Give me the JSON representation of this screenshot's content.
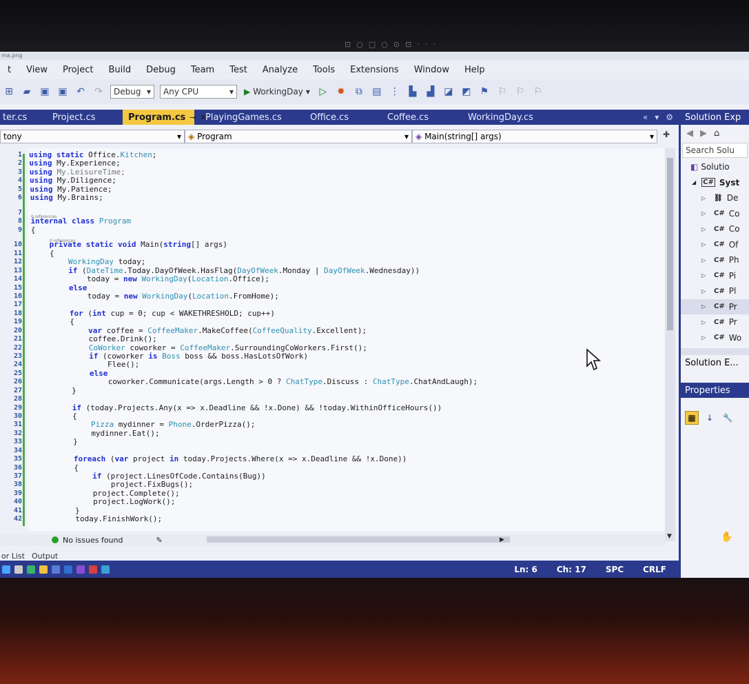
{
  "window": {
    "title_fragment": "ma.png"
  },
  "menu": [
    "t",
    "View",
    "Project",
    "Build",
    "Debug",
    "Team",
    "Test",
    "Analyze",
    "Tools",
    "Extensions",
    "Window",
    "Help"
  ],
  "toolbar": {
    "configuration": "Debug",
    "platform": "Any CPU",
    "startup_project": "WorkingDay"
  },
  "tabs": [
    {
      "label": "ter.cs",
      "active": false
    },
    {
      "label": "Project.cs",
      "active": false
    },
    {
      "label": "Program.cs",
      "active": true
    },
    {
      "label": "PlayingGames.cs",
      "active": false
    },
    {
      "label": "Office.cs",
      "active": false
    },
    {
      "label": "Coffee.cs",
      "active": false
    },
    {
      "label": "WorkingDay.cs",
      "active": false
    }
  ],
  "navbar": {
    "project": "tony",
    "class": "Program",
    "member": "Main(string[] args)"
  },
  "editor": {
    "lines": [
      {
        "n": "1",
        "html": "<span class='kw'>using static</span> Office.<span class='ty'>Kitchen</span>;"
      },
      {
        "n": "2",
        "html": "<span class='kw'>using</span> My.Experience;"
      },
      {
        "n": "3",
        "html": "<span class='kw'>using</span> <span style='color:#777'>My.LeisureTime;</span>"
      },
      {
        "n": "4",
        "html": "<span class='kw'>using</span> My.Diligence;"
      },
      {
        "n": "5",
        "html": "<span class='kw'>using</span> My.Patience;"
      },
      {
        "n": "6",
        "html": "<span class='kw'>using</span> My.Brains;"
      },
      {
        "n": "7",
        "html": ""
      },
      {
        "n": "8",
        "html": "<span class='kw'>internal class</span> <span class='ty'>Program</span>"
      },
      {
        "n": "9",
        "html": "{"
      },
      {
        "n": "10",
        "html": "    <span class='kw'>private static void</span> Main(<span class='kw'>string</span>[] args)"
      },
      {
        "n": "11",
        "html": "    {"
      },
      {
        "n": "12",
        "html": "        <span class='ty'>WorkingDay</span> today;"
      },
      {
        "n": "13",
        "html": "        <span class='kw'>if</span> (<span class='ty'>DateTime</span>.Today.DayOfWeek.HasFlag(<span class='ty'>DayOfWeek</span>.Monday | <span class='ty'>DayOfWeek</span>.Wednesday))"
      },
      {
        "n": "14",
        "html": "            today = <span class='kw'>new</span> <span class='ty'>WorkingDay</span>(<span class='ty'>Location</span>.Office);"
      },
      {
        "n": "15",
        "html": "        <span class='kw'>else</span>"
      },
      {
        "n": "16",
        "html": "            today = <span class='kw'>new</span> <span class='ty'>WorkingDay</span>(<span class='ty'>Location</span>.FromHome);"
      },
      {
        "n": "17",
        "html": ""
      },
      {
        "n": "18",
        "html": "        <span class='kw'>for</span> (<span class='kw'>int</span> cup = 0; cup &lt; WAKETHRESHOLD; cup++)"
      },
      {
        "n": "19",
        "html": "        {"
      },
      {
        "n": "20",
        "html": "            <span class='kw'>var</span> coffee = <span class='ty'>CoffeeMaker</span>.MakeCoffee(<span class='ty'>CoffeeQuality</span>.Excellent);"
      },
      {
        "n": "21",
        "html": "            coffee.Drink();"
      },
      {
        "n": "22",
        "html": "            <span class='ty'>CoWorker</span> coworker = <span class='ty'>CoffeeMaker</span>.SurroundingCoWorkers.First();"
      },
      {
        "n": "23",
        "html": "            <span class='kw'>if</span> (coworker <span class='kw'>is</span> <span class='ty'>Boss</span> boss &amp;&amp; boss.HasLotsOfWork)"
      },
      {
        "n": "24",
        "html": "                Flee();"
      },
      {
        "n": "25",
        "html": "            <span class='kw'>else</span>"
      },
      {
        "n": "26",
        "html": "                coworker.Communicate(args.Length &gt; 0 ? <span class='ty'>ChatType</span>.Discuss : <span class='ty'>ChatType</span>.ChatAndLaugh);"
      },
      {
        "n": "27",
        "html": "        }"
      },
      {
        "n": "28",
        "html": ""
      },
      {
        "n": "29",
        "html": "        <span class='kw'>if</span> (today.Projects.Any(x =&gt; x.Deadline &amp;&amp; !x.Done) &amp;&amp; !today.WithinOfficeHours())"
      },
      {
        "n": "30",
        "html": "        {"
      },
      {
        "n": "31",
        "html": "            <span class='ty'>Pizza</span> mydinner = <span class='ty'>Phone</span>.OrderPizza();"
      },
      {
        "n": "32",
        "html": "            mydinner.Eat();"
      },
      {
        "n": "33",
        "html": "        }"
      },
      {
        "n": "34",
        "html": ""
      },
      {
        "n": "35",
        "html": "        <span class='kw'>foreach</span> (<span class='kw'>var</span> project <span class='kw'>in</span> today.Projects.Where(x =&gt; x.Deadline &amp;&amp; !x.Done))"
      },
      {
        "n": "36",
        "html": "        {"
      },
      {
        "n": "37",
        "html": "            <span class='kw'>if</span> (project.LinesOfCode.Contains(Bug))"
      },
      {
        "n": "38",
        "html": "                project.FixBugs();"
      },
      {
        "n": "39",
        "html": "            project.Complete();"
      },
      {
        "n": "40",
        "html": "            project.LogWork();"
      },
      {
        "n": "41",
        "html": "        }"
      },
      {
        "n": "42",
        "html": "        today.FinishWork();"
      }
    ],
    "refs": [
      "0 references",
      "0 references"
    ]
  },
  "status": {
    "issues": "No issues found",
    "ln": "Ln: 6",
    "ch": "Ch: 17",
    "mode": "SPC",
    "eol": "CRLF"
  },
  "bottom_tabs": [
    "or List",
    "Output"
  ],
  "solution_explorer": {
    "title": "Solution Exp",
    "search": "Search Solu",
    "root": "Solutio",
    "project": "Syst",
    "items": [
      "De",
      "Co",
      "Co",
      "Of",
      "Ph",
      "Pi",
      "Pl",
      "Pr",
      "Pr",
      "Wo"
    ],
    "footer_tab": "Solution E..."
  },
  "properties": {
    "title": "Properties"
  },
  "colors": {
    "accent": "#2b3a8c",
    "active_tab": "#f5c842",
    "keyword": "#1f2fd0",
    "type": "#2b8fb0"
  }
}
